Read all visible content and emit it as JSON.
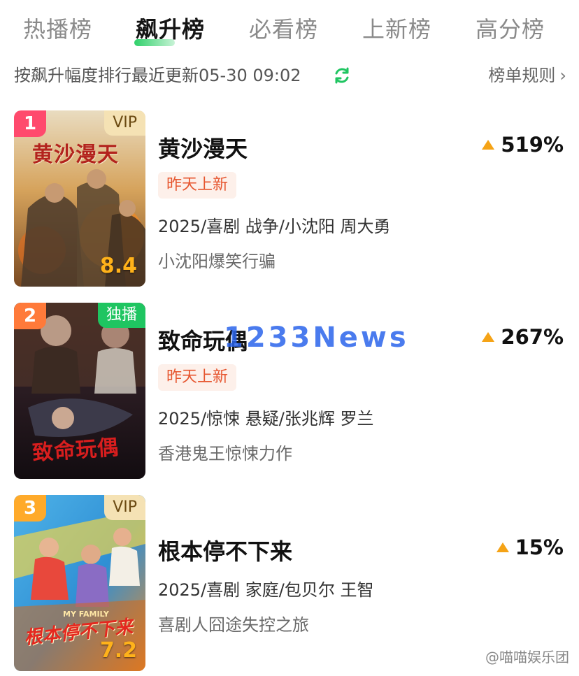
{
  "tabs": [
    {
      "label": "热播榜",
      "active": false
    },
    {
      "label": "飙升榜",
      "active": true
    },
    {
      "label": "必看榜",
      "active": false
    },
    {
      "label": "上新榜",
      "active": false
    },
    {
      "label": "高分榜",
      "active": false
    }
  ],
  "subheader": {
    "text": "按飙升幅度排行最近更新05-30 09:02",
    "rules_label": "榜单规则",
    "refresh_icon": "refresh-icon",
    "accent": "#1fc561"
  },
  "items": [
    {
      "rank": "1",
      "badge": "VIP",
      "badge_type": "vip",
      "poster_text": "黄沙漫天",
      "poster_score": "8.4",
      "title": "黄沙漫天",
      "new_tag": "昨天上新",
      "trend": "519%",
      "meta": "2025/喜剧 战争/小沈阳 周大勇",
      "desc": "小沈阳爆笑行骗",
      "rank_color": "#ff4a6d"
    },
    {
      "rank": "2",
      "badge": "独播",
      "badge_type": "exclusive",
      "poster_text": "致命玩偶",
      "poster_score": "",
      "title": "致命玩偶",
      "new_tag": "昨天上新",
      "trend": "267%",
      "meta": "2025/惊悚 悬疑/张兆辉 罗兰",
      "desc": "香港鬼王惊悚力作",
      "rank_color": "#ff7a3a"
    },
    {
      "rank": "3",
      "badge": "VIP",
      "badge_type": "vip",
      "poster_text": "根本停不下来",
      "poster_subtitle": "MY FAMILY",
      "poster_score": "7.2",
      "title": "根本停不下来",
      "new_tag": "",
      "trend": "15%",
      "meta": "2025/喜剧 家庭/包贝尔 王智",
      "desc": "喜剧人囧途失控之旅",
      "rank_color": "#ffaa2a"
    }
  ],
  "watermark": "1233News",
  "source_mark": "@喵喵娱乐团",
  "colors": {
    "trend_up": "#f5a316",
    "new_tag_bg": "#fdf0ea",
    "new_tag_text": "#e6552e"
  }
}
